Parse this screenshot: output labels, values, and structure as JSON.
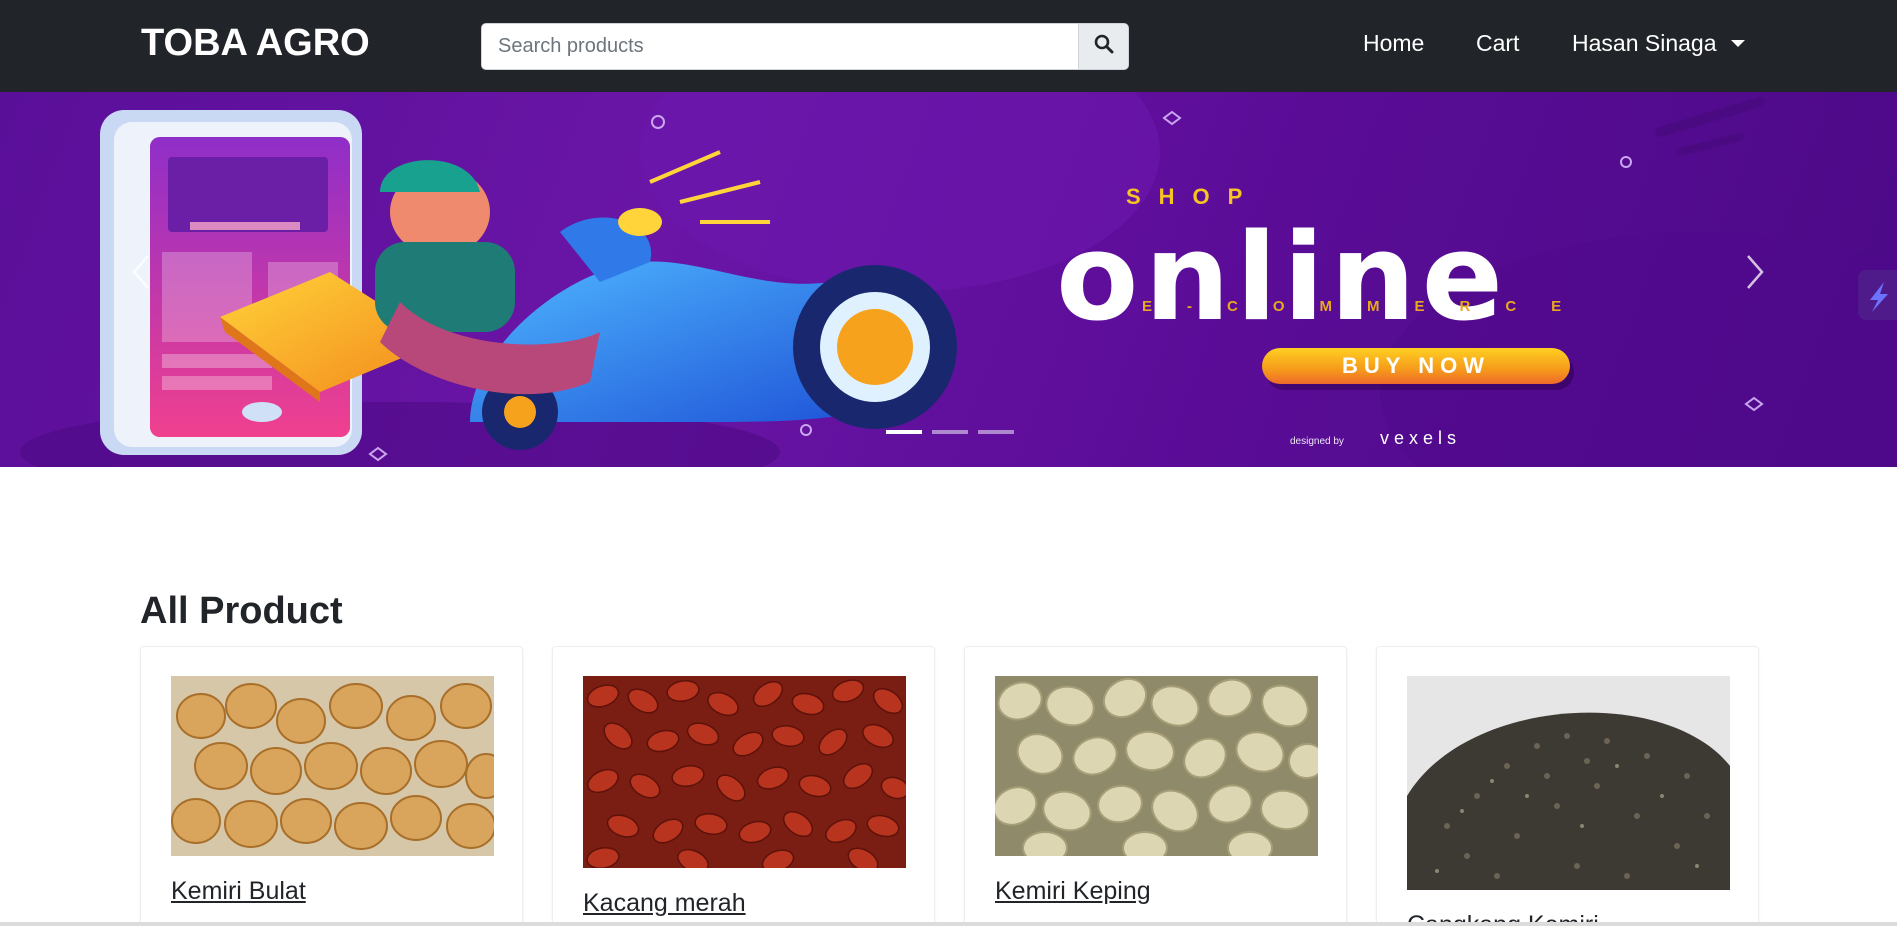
{
  "navbar": {
    "brand": "TOBA AGRO",
    "search_placeholder": "Search products",
    "links": {
      "home": "Home",
      "cart": "Cart",
      "user": "Hasan Sinaga"
    }
  },
  "carousel": {
    "shop_text": "SHOP",
    "headline": "online",
    "subline": "E-COMMERCE",
    "cta": "BUY NOW",
    "credit_prefix": "designed by",
    "credit_brand": "vexels",
    "slide_count": 3,
    "active_slide": 1
  },
  "products_section": {
    "title": "All Product",
    "items": [
      {
        "name": "Kemiri Bulat",
        "image": "candlenut-whole-photo"
      },
      {
        "name": "Kacang merah",
        "image": "red-beans-photo"
      },
      {
        "name": "Kemiri Keping",
        "image": "candlenut-pieces-photo"
      },
      {
        "name": "Cangkang Kemiri",
        "image": "candlenut-shell-photo"
      }
    ]
  },
  "colors": {
    "navbar_bg": "#212529",
    "banner_purple": "#5a0f99",
    "accent_yellow": "#f6c423"
  }
}
